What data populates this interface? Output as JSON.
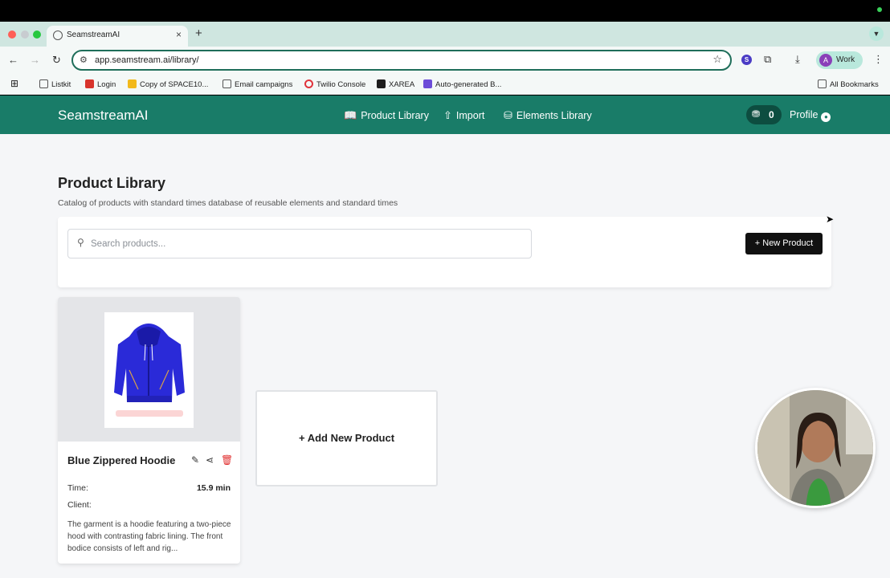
{
  "browser": {
    "tab_title": "SeamstreamAI",
    "tab_close": "×",
    "new_tab": "+",
    "url": "app.seamstream.ai/library/",
    "profile_initial": "A",
    "profile_name": "Work",
    "extension_initial": "S"
  },
  "bookmarks": {
    "items": [
      "Listkit",
      "Login",
      "Copy of SPACE10...",
      "Email campaigns",
      "Twilio Console",
      "XAREA",
      "Auto-generated B..."
    ],
    "all": "All Bookmarks"
  },
  "app": {
    "brand": "SeamstreamAI",
    "nav": [
      "Product Library",
      "Import",
      "Elements Library"
    ],
    "credits": "0",
    "profile": "Profile",
    "accent": "#197c68"
  },
  "page": {
    "title": "Product Library",
    "subtitle": "Catalog of products with standard times database of reusable elements and standard times",
    "search_placeholder": "Search products...",
    "new_product": "+ New Product",
    "add_new_product": "+ Add New Product"
  },
  "product": {
    "name": "Blue Zippered Hoodie",
    "time_label": "Time:",
    "time_value": "15.9 min",
    "client_label": "Client:",
    "description": "The garment is a hoodie featuring a two-piece hood with contrasting fabric lining. The front bodice consists of left and rig..."
  }
}
